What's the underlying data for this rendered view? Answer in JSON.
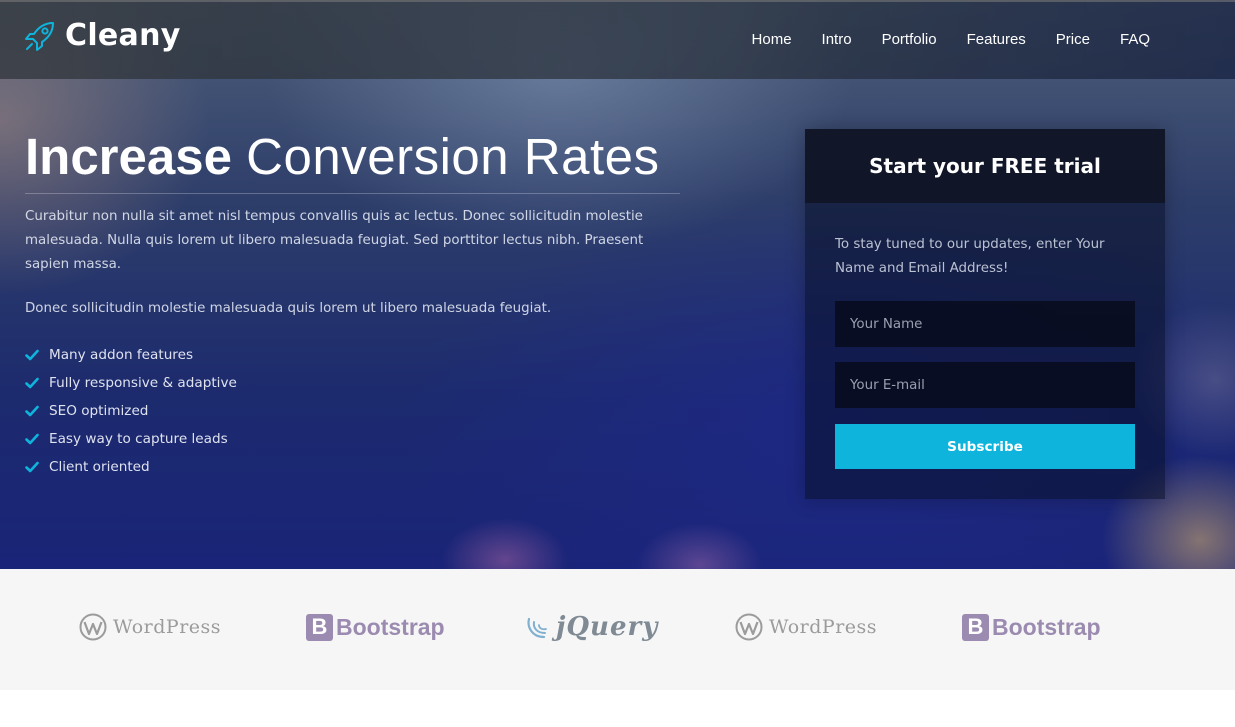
{
  "brand": {
    "name": "Cleany",
    "icon": "rocket-icon",
    "accent": "#0fb4dc"
  },
  "nav": {
    "items": [
      {
        "label": "Home"
      },
      {
        "label": "Intro"
      },
      {
        "label": "Portfolio"
      },
      {
        "label": "Features"
      },
      {
        "label": "Price"
      },
      {
        "label": "FAQ"
      }
    ]
  },
  "hero": {
    "headline_strong": "Increase",
    "headline_light": "Conversion Rates",
    "paragraph1": "Curabitur non nulla sit amet nisl tempus convallis quis ac lectus. Donec sollicitudin molestie malesuada. Nulla quis lorem ut libero malesuada feugiat. Sed porttitor lectus nibh. Praesent sapien massa.",
    "paragraph2": "Donec sollicitudin molestie malesuada quis lorem ut libero malesuada feugiat.",
    "features": [
      {
        "label": "Many addon features"
      },
      {
        "label": "Fully responsive & adaptive"
      },
      {
        "label": "SEO optimized"
      },
      {
        "label": "Easy way to capture leads"
      },
      {
        "label": "Client oriented"
      }
    ],
    "check_icon": "check-icon"
  },
  "signup": {
    "title": "Start your FREE trial",
    "text": "To stay tuned to our updates, enter Your Name and Email Address!",
    "name_placeholder": "Your Name",
    "email_placeholder": "Your E-mail",
    "button_label": "Subscribe",
    "button_color": "#0fb4dc"
  },
  "logos": [
    {
      "name": "WordPress",
      "text": "WordPress"
    },
    {
      "name": "Bootstrap",
      "text": "Bootstrap"
    },
    {
      "name": "jQuery",
      "text": "jQuery"
    },
    {
      "name": "WordPress",
      "text": "WordPress"
    },
    {
      "name": "Bootstrap",
      "text": "Bootstrap"
    }
  ]
}
